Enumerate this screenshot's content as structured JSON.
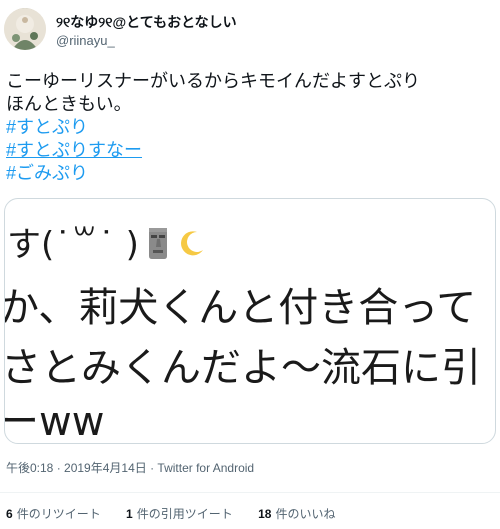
{
  "author": {
    "display_name": "୨୧なゆ୨୧@とてもおとなしい",
    "handle": "@riinayu_"
  },
  "tweet": {
    "text_lines": [
      "こーゆーリスナーがいるからキモイんだよすとぷり",
      "ほんときもい。"
    ],
    "hashtags": [
      "#すとぷり",
      "#すとぷりすなー",
      "#ごみぷり"
    ]
  },
  "media": {
    "lines": [
      "す(˙꒳˙ )",
      "か、莉犬くんと付き合って",
      "さとみくんだよ～流石に引",
      "ーww"
    ],
    "emoji_names": [
      "moai-icon",
      "crescent-moon-icon"
    ]
  },
  "meta": {
    "timestamp": "午後0:18 · 2019年4月14日 · Twitter for Android"
  },
  "stats": {
    "retweets_count": "6",
    "retweets_label": "件のリツイート",
    "quotes_count": "1",
    "quotes_label": "件の引用ツイート",
    "likes_count": "18",
    "likes_label": "件のいいね"
  },
  "colors": {
    "link": "#1d9bf0",
    "secondary_text": "#536471",
    "primary_text": "#0f1419",
    "border": "#cfd9de"
  }
}
